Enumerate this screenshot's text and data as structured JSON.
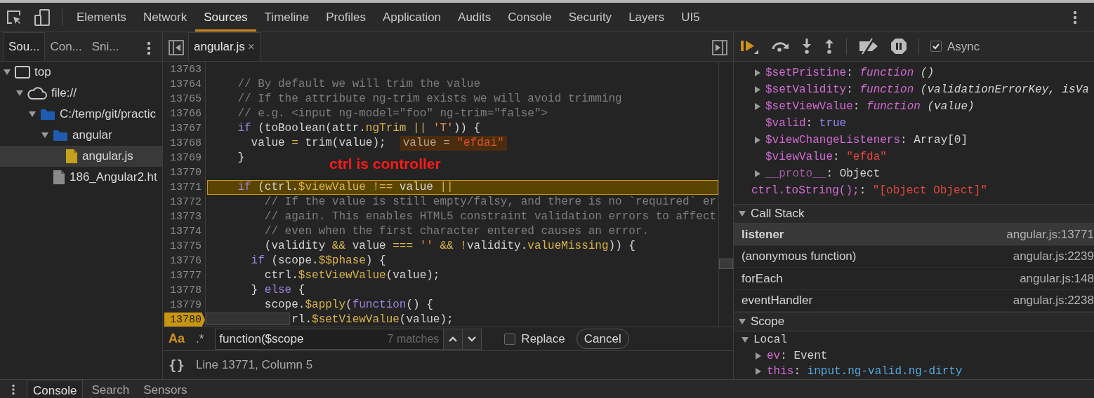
{
  "main_tabs": [
    {
      "label": "Elements",
      "selected": false
    },
    {
      "label": "Network",
      "selected": false
    },
    {
      "label": "Sources",
      "selected": true
    },
    {
      "label": "Timeline",
      "selected": false
    },
    {
      "label": "Profiles",
      "selected": false
    },
    {
      "label": "Application",
      "selected": false
    },
    {
      "label": "Audits",
      "selected": false
    },
    {
      "label": "Console",
      "selected": false
    },
    {
      "label": "Security",
      "selected": false
    },
    {
      "label": "Layers",
      "selected": false
    },
    {
      "label": "UI5",
      "selected": false
    }
  ],
  "navigator": {
    "tabs": [
      {
        "label": "Sou...",
        "selected": true
      },
      {
        "label": "Con...",
        "selected": false
      },
      {
        "label": "Sni...",
        "selected": false
      }
    ],
    "tree": [
      {
        "label": "top",
        "kind": "frame",
        "expanded": true,
        "selected": false,
        "children": [
          {
            "label": "file://",
            "kind": "origin",
            "expanded": true,
            "selected": false,
            "children": [
              {
                "label": "C:/temp/git/practic",
                "kind": "folder",
                "expanded": true,
                "selected": false,
                "children": [
                  {
                    "label": "angular",
                    "kind": "folder",
                    "expanded": true,
                    "selected": false,
                    "children": [
                      {
                        "label": "angular.js",
                        "kind": "script",
                        "selected": true
                      }
                    ]
                  },
                  {
                    "label": "186_Angular2.ht",
                    "kind": "document",
                    "selected": false
                  }
                ]
              }
            ]
          }
        ]
      }
    ]
  },
  "editor": {
    "tabs": [
      {
        "label": "angular.js",
        "close": "×",
        "selected": true
      }
    ],
    "lines": [
      {
        "number": "13763",
        "current": false,
        "breakpoint": false
      },
      {
        "number": "13764",
        "current": false,
        "breakpoint": false,
        "tokens": [
          {
            "kind": "comment",
            "text": "    // By default we will trim the value"
          }
        ]
      },
      {
        "number": "13765",
        "current": false,
        "breakpoint": false,
        "tokens": [
          {
            "kind": "comment",
            "text": "    // If the attribute ng-trim exists we will avoid trimming"
          }
        ]
      },
      {
        "number": "13766",
        "current": false,
        "breakpoint": false,
        "tokens": [
          {
            "kind": "comment",
            "text": "    // e.g. <input ng-model=\"foo\" ng-trim=\"false\">"
          }
        ]
      },
      {
        "number": "13767",
        "current": false,
        "breakpoint": false,
        "tokens": [
          {
            "kind": "keyword",
            "text": "    if"
          },
          {
            "kind": "plain",
            "text": " (toBoolean(attr."
          },
          {
            "kind": "property",
            "text": "ngTrim"
          },
          {
            "kind": "operator",
            "text": " ||"
          },
          {
            "kind": "string",
            "text": " 'T'"
          },
          {
            "kind": "plain",
            "text": ")) {"
          }
        ]
      },
      {
        "number": "13768",
        "current": false,
        "breakpoint": false,
        "tokens": [
          {
            "kind": "plain",
            "text": "      value "
          },
          {
            "kind": "operator",
            "text": "="
          },
          {
            "kind": "plain",
            "text": " trim(value);"
          }
        ],
        "inline_value": [
          {
            "kind": "plain",
            "text": "value = "
          },
          {
            "kind": "string",
            "text": "\"efdai\""
          }
        ]
      },
      {
        "number": "13769",
        "current": false,
        "breakpoint": false,
        "tokens": [
          {
            "kind": "plain",
            "text": "    }"
          }
        ]
      },
      {
        "number": "13770",
        "current": false,
        "breakpoint": false
      },
      {
        "number": "13771",
        "current": true,
        "breakpoint": false,
        "tokens": [
          {
            "kind": "keyword",
            "text": "    if"
          },
          {
            "kind": "plain",
            "text": " (ctrl."
          },
          {
            "kind": "property",
            "text": "$viewValue"
          },
          {
            "kind": "operator",
            "text": " !=="
          },
          {
            "kind": "plain",
            "text": " value "
          },
          {
            "kind": "operator",
            "text": "||"
          }
        ]
      },
      {
        "number": "13772",
        "current": false,
        "breakpoint": false,
        "tokens": [
          {
            "kind": "comment",
            "text": "        // If the value is still empty/falsy, and there is no `required` er"
          }
        ]
      },
      {
        "number": "13773",
        "current": false,
        "breakpoint": false,
        "tokens": [
          {
            "kind": "comment",
            "text": "        // again. This enables HTML5 constraint validation errors to affect"
          }
        ]
      },
      {
        "number": "13774",
        "current": false,
        "breakpoint": false,
        "tokens": [
          {
            "kind": "comment",
            "text": "        // even when the first character entered causes an error."
          }
        ]
      },
      {
        "number": "13775",
        "current": false,
        "breakpoint": false,
        "tokens": [
          {
            "kind": "plain",
            "text": "        (validity "
          },
          {
            "kind": "operator",
            "text": "&&"
          },
          {
            "kind": "plain",
            "text": " value "
          },
          {
            "kind": "operator",
            "text": "==="
          },
          {
            "kind": "string",
            "text": " ''"
          },
          {
            "kind": "operator",
            "text": " && !"
          },
          {
            "kind": "plain",
            "text": "validity."
          },
          {
            "kind": "property",
            "text": "valueMissing"
          },
          {
            "kind": "plain",
            "text": ")) {"
          }
        ]
      },
      {
        "number": "13776",
        "current": false,
        "breakpoint": false,
        "tokens": [
          {
            "kind": "keyword",
            "text": "      if"
          },
          {
            "kind": "plain",
            "text": " (scope."
          },
          {
            "kind": "property",
            "text": "$$phase"
          },
          {
            "kind": "plain",
            "text": ") {"
          }
        ]
      },
      {
        "number": "13777",
        "current": false,
        "breakpoint": false,
        "tokens": [
          {
            "kind": "plain",
            "text": "        ctrl."
          },
          {
            "kind": "property",
            "text": "$setViewValue"
          },
          {
            "kind": "plain",
            "text": "(value);"
          }
        ]
      },
      {
        "number": "13778",
        "current": false,
        "breakpoint": false,
        "tokens": [
          {
            "kind": "plain",
            "text": "      } "
          },
          {
            "kind": "keyword",
            "text": "else"
          },
          {
            "kind": "plain",
            "text": " {"
          }
        ]
      },
      {
        "number": "13779",
        "current": false,
        "breakpoint": false,
        "tokens": [
          {
            "kind": "plain",
            "text": "        scope."
          },
          {
            "kind": "property",
            "text": "$apply"
          },
          {
            "kind": "plain",
            "text": "("
          },
          {
            "kind": "keyword",
            "text": "function"
          },
          {
            "kind": "plain",
            "text": "() {"
          }
        ]
      },
      {
        "number": "13780",
        "current": false,
        "breakpoint": true,
        "tokens": [
          {
            "kind": "plain",
            "text": "            rl."
          },
          {
            "kind": "property",
            "text": "$setViewValue"
          },
          {
            "kind": "plain",
            "text": "(value);"
          }
        ]
      }
    ],
    "annotation": "ctrl is controller",
    "search": {
      "case_label": "Aa",
      "case_sensitive": true,
      "regex_label": ".*",
      "regex": false,
      "value": "function($scope",
      "match_count": "7 matches",
      "replace_label": "Replace",
      "replace": false,
      "cancel": "Cancel"
    },
    "status": {
      "pretty_print": "{}",
      "position": "Line 13771, Column 5"
    }
  },
  "debugger": {
    "async": {
      "label": "Async",
      "checked": true
    },
    "watch": [
      {
        "kind": "property",
        "expandable": true,
        "tokens": [
          {
            "kind": "name",
            "text": "$setPristine"
          },
          {
            "kind": "punct",
            "text": ": "
          },
          {
            "kind": "function",
            "text": "function"
          },
          {
            "kind": "signature",
            "text": " ()"
          }
        ]
      },
      {
        "kind": "property",
        "expandable": true,
        "tokens": [
          {
            "kind": "name",
            "text": "$setValidity"
          },
          {
            "kind": "punct",
            "text": ": "
          },
          {
            "kind": "function",
            "text": "function"
          },
          {
            "kind": "signature",
            "text": " (validationErrorKey, isVa"
          }
        ]
      },
      {
        "kind": "property",
        "expandable": true,
        "tokens": [
          {
            "kind": "name",
            "text": "$setViewValue"
          },
          {
            "kind": "punct",
            "text": ": "
          },
          {
            "kind": "function",
            "text": "function"
          },
          {
            "kind": "signature",
            "text": " (value)"
          }
        ]
      },
      {
        "kind": "property",
        "expandable": false,
        "tokens": [
          {
            "kind": "name",
            "text": "$valid"
          },
          {
            "kind": "punct",
            "text": ": "
          },
          {
            "kind": "boolean",
            "text": "true"
          }
        ]
      },
      {
        "kind": "property",
        "expandable": true,
        "tokens": [
          {
            "kind": "name",
            "text": "$viewChangeListeners"
          },
          {
            "kind": "punct",
            "text": ": "
          },
          {
            "kind": "object",
            "text": "Array[0]"
          }
        ]
      },
      {
        "kind": "property",
        "expandable": false,
        "tokens": [
          {
            "kind": "name",
            "text": "$viewValue"
          },
          {
            "kind": "punct",
            "text": ": "
          },
          {
            "kind": "string",
            "text": "\"efda\""
          }
        ]
      },
      {
        "kind": "property",
        "expandable": true,
        "tokens": [
          {
            "kind": "proto",
            "text": "__proto__"
          },
          {
            "kind": "punct",
            "text": ": "
          },
          {
            "kind": "object",
            "text": "Object"
          }
        ]
      },
      {
        "kind": "expression",
        "tokens": [
          {
            "kind": "name",
            "text": "ctrl.toString();"
          },
          {
            "kind": "punct",
            "text": ": "
          },
          {
            "kind": "string",
            "text": "\"[object Object]\""
          }
        ]
      }
    ],
    "call_stack": {
      "title": "Call Stack",
      "expanded": true,
      "frames": [
        {
          "function": "listener",
          "location": "angular.js:13771",
          "selected": true
        },
        {
          "function": "(anonymous function)",
          "location": "angular.js:2239",
          "selected": false
        },
        {
          "function": "forEach",
          "location": "angular.js:148",
          "selected": false
        },
        {
          "function": "eventHandler",
          "location": "angular.js:2238",
          "selected": false
        }
      ]
    },
    "scope": {
      "title": "Scope",
      "expanded": true,
      "sections": [
        {
          "label": "Local",
          "expanded": true,
          "variables": [
            {
              "tokens": [
                {
                  "kind": "name",
                  "text": "ev"
                },
                {
                  "kind": "punct",
                  "text": ": "
                },
                {
                  "kind": "object",
                  "text": "Event"
                }
              ]
            },
            {
              "tokens": [
                {
                  "kind": "name",
                  "text": "this"
                },
                {
                  "kind": "punct",
                  "text": ": "
                },
                {
                  "kind": "node",
                  "text": "input.ng-valid.ng-dirty"
                }
              ]
            }
          ]
        }
      ]
    }
  },
  "drawer": {
    "tabs": [
      {
        "label": "Console",
        "selected": true
      },
      {
        "label": "Search",
        "selected": false
      },
      {
        "label": "Sensors",
        "selected": false
      }
    ]
  }
}
